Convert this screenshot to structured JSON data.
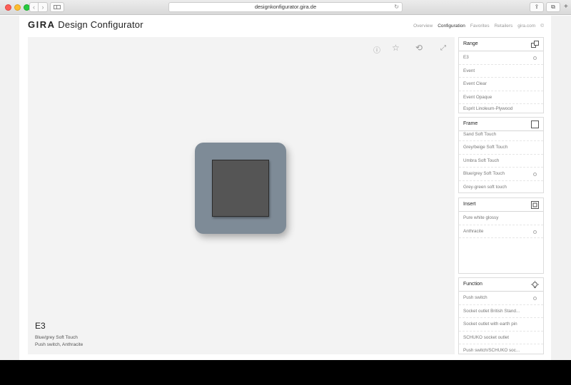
{
  "browser": {
    "url": "designkonfigurator.gira.de",
    "back_icon": "‹",
    "forward_icon": "›",
    "reload_icon": "↻",
    "share_icon": "⇪",
    "tabs_icon": "⧉",
    "newtab_icon": "+"
  },
  "header": {
    "brand_bold": "GIRA",
    "brand_rest": " Design Configurator",
    "nav": [
      "Overview",
      "Configuration",
      "Favorites",
      "Retailers",
      "gira.com",
      "©"
    ]
  },
  "stage": {
    "tools": {
      "info": "ⓘ",
      "favorite": "☆",
      "rotate": "⟲",
      "fullscreen": "⤢"
    },
    "product_name": "E3",
    "product_line1": "Blue/grey Soft Touch",
    "product_line2": "Push switch, Anthracite",
    "frame_color": "#7e8b97",
    "insert_color": "#555555"
  },
  "panels": {
    "range": {
      "title": "Range",
      "items": [
        "E3",
        "Event",
        "Event Clear",
        "Event Opaque",
        "Esprit Linoleum-Plywood"
      ],
      "selected": "E3"
    },
    "frame": {
      "title": "Frame",
      "items": [
        "Sand Soft Touch",
        "Grey/beige Soft Touch",
        "Umbra Soft Touch",
        "Blue/grey Soft Touch",
        "Grey-green soft touch"
      ],
      "selected": "Blue/grey Soft Touch"
    },
    "insert": {
      "title": "Insert",
      "items": [
        "Pure white glossy",
        "Anthracite"
      ],
      "selected": "Anthracite"
    },
    "function": {
      "title": "Function",
      "items": [
        "Push switch",
        "Socket outlet British Stand...",
        "Socket outlet with earth pin",
        "SCHUKO socket outlet",
        "Push switch/SCHUKO soc..."
      ],
      "selected": "Push switch"
    }
  }
}
